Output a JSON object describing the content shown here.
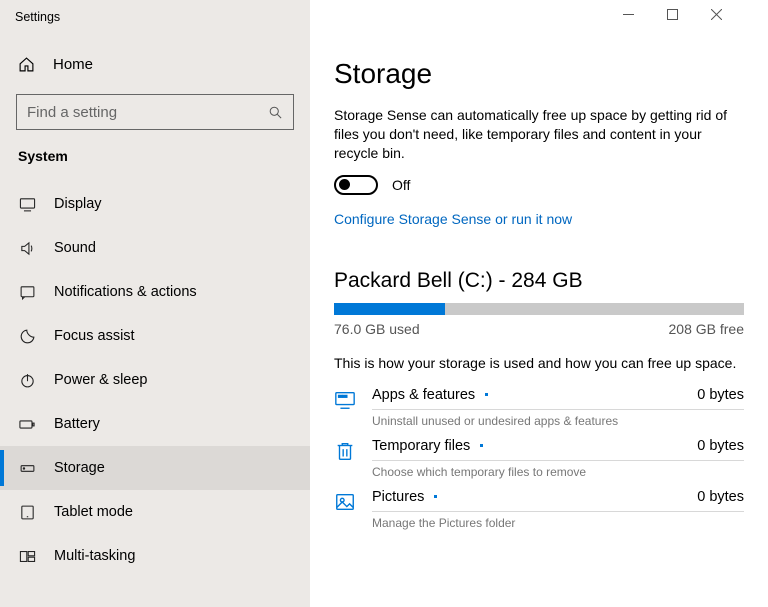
{
  "window": {
    "title": "Settings"
  },
  "sidebar": {
    "home_label": "Home",
    "search_placeholder": "Find a setting",
    "section_label": "System",
    "items": [
      {
        "label": "Display"
      },
      {
        "label": "Sound"
      },
      {
        "label": "Notifications & actions"
      },
      {
        "label": "Focus assist"
      },
      {
        "label": "Power & sleep"
      },
      {
        "label": "Battery"
      },
      {
        "label": "Storage"
      },
      {
        "label": "Tablet mode"
      },
      {
        "label": "Multi-tasking"
      }
    ]
  },
  "main": {
    "title": "Storage",
    "sense_desc": "Storage Sense can automatically free up space by getting rid of files you don't need, like temporary files and content in your recycle bin.",
    "toggle_state_label": "Off",
    "toggle_on": false,
    "configure_link": "Configure Storage Sense or run it now",
    "drive": {
      "header": "Packard Bell (C:) - 284 GB",
      "fill_percent": 27,
      "used_label": "76.0 GB used",
      "free_label": "208 GB free"
    },
    "usage_desc": "This is how your storage is used and how you can free up space.",
    "categories": [
      {
        "name": "Apps & features",
        "size": "0 bytes",
        "sub": "Uninstall unused or undesired apps & features"
      },
      {
        "name": "Temporary files",
        "size": "0 bytes",
        "sub": "Choose which temporary files to remove"
      },
      {
        "name": "Pictures",
        "size": "0 bytes",
        "sub": "Manage the Pictures folder"
      }
    ]
  }
}
